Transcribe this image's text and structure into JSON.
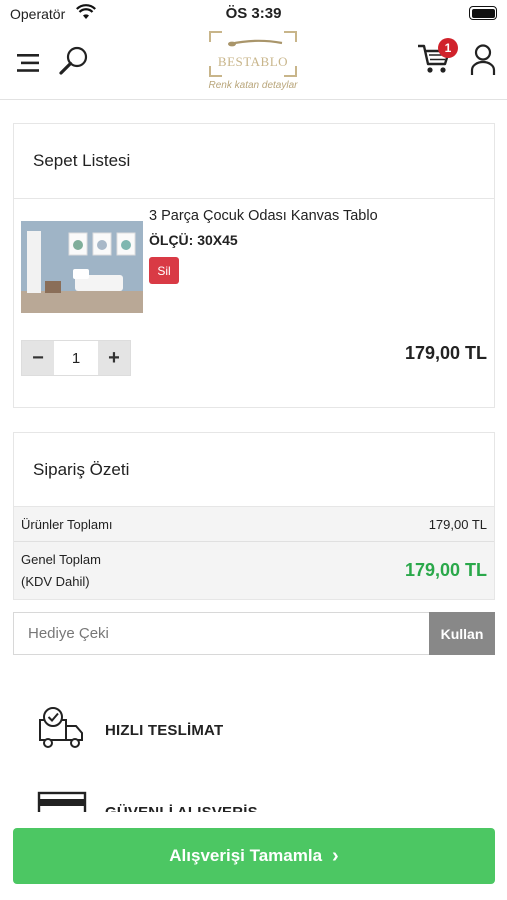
{
  "status_bar": {
    "carrier": "Operatör",
    "time": "ÖS 3:39"
  },
  "header": {
    "logo_text": "BESTABLO",
    "logo_tagline": "Renk katan detaylar",
    "cart_count": "1"
  },
  "cart": {
    "title": "Sepet Listesi",
    "item": {
      "name": "3 Parça Çocuk Odası Kanvas Tablo",
      "size": "ÖLÇÜ: 30X45",
      "delete_label": "Sil",
      "quantity": "1",
      "minus": "−",
      "plus": "+",
      "price": "179,00 TL"
    }
  },
  "summary": {
    "title": "Sipariş Özeti",
    "products_total_label": "Ürünler Toplamı",
    "products_total_value": "179,00 TL",
    "grand_total_label_line1": "Genel Toplam",
    "grand_total_label_line2": "(KDV Dahil)",
    "grand_total_value": "179,00 TL"
  },
  "coupon": {
    "placeholder": "Hediye Çeki",
    "button_label": "Kullan"
  },
  "features": [
    {
      "label": "HIZLI TESLİMAT",
      "icon": "delivery-truck-icon"
    },
    {
      "label": "GÜVENLİ ALIŞVERİŞ",
      "icon": "credit-card-icon"
    }
  ],
  "checkout": {
    "label": "Alışverişi Tamamla",
    "chevron": "›"
  },
  "colors": {
    "accent_green": "#4cc763",
    "total_green": "#2aa84a",
    "delete_red": "#d93a45",
    "badge_red": "#d0222b"
  }
}
